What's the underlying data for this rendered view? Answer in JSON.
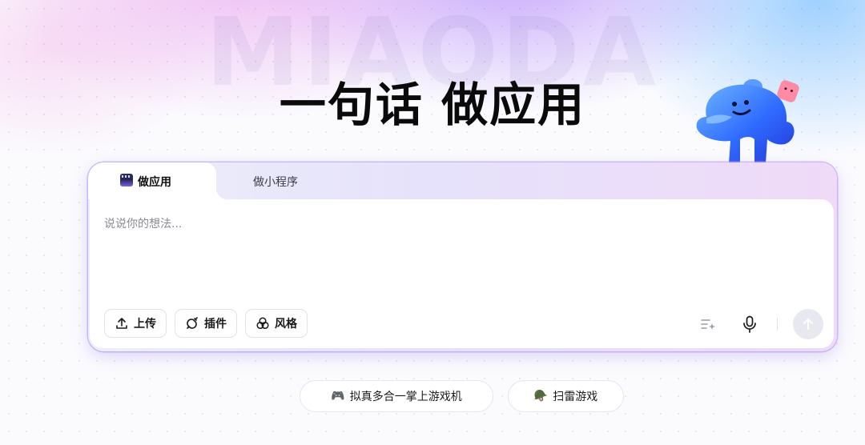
{
  "brand": {
    "watermark": "MIAODA"
  },
  "hero": {
    "headline": "一句话 做应用"
  },
  "composer": {
    "tabs": [
      {
        "label": "做应用",
        "active": true,
        "icon": "app-window-icon"
      },
      {
        "label": "做小程序",
        "active": false
      }
    ],
    "input": {
      "value": "",
      "placeholder": "说说你的想法..."
    },
    "tools": [
      {
        "label": "上传",
        "icon": "upload-icon"
      },
      {
        "label": "插件",
        "icon": "plugin-icon"
      },
      {
        "label": "风格",
        "icon": "style-icon"
      }
    ],
    "actions": {
      "enhance_icon": "prompt-enhance-icon",
      "mic_icon": "microphone-icon",
      "send_icon": "arrow-up-icon"
    }
  },
  "suggestions": [
    {
      "emoji": "🎮",
      "label": "拟真多合一掌上游戏机"
    },
    {
      "emoji": "🪖",
      "label": "扫雷游戏"
    }
  ],
  "colors": {
    "accent": "#7b62e8",
    "send_disabled": "#e8e9f0"
  }
}
